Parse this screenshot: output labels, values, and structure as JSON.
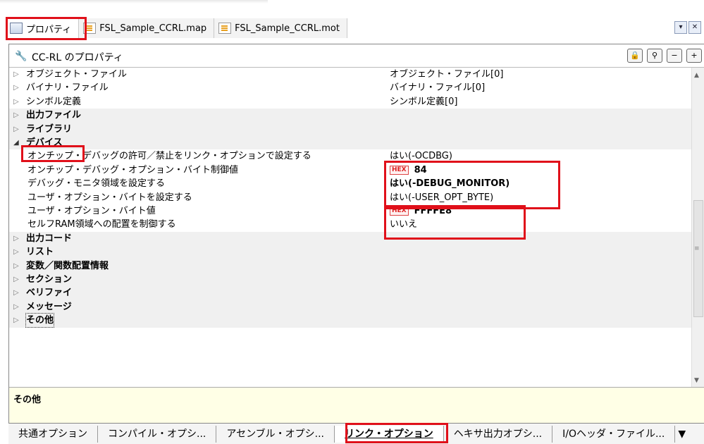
{
  "top_tabs": [
    {
      "label": "プロパティ"
    },
    {
      "label": "FSL_Sample_CCRL.map"
    },
    {
      "label": "FSL_Sample_CCRL.mot"
    }
  ],
  "window_buttons": {
    "dropdown": "▾",
    "close": "✕"
  },
  "panel": {
    "title": "CC-RL のプロパティ",
    "icons": {
      "lock": "🔒",
      "search": "⚲",
      "minus": "−",
      "plus": "+"
    }
  },
  "rows": [
    {
      "name": "オブジェクト・ファイル",
      "value": "オブジェクト・ファイル[0]"
    },
    {
      "name": "バイナリ・ファイル",
      "value": "バイナリ・ファイル[0]"
    },
    {
      "name": "シンボル定義",
      "value": "シンボル定義[0]"
    },
    {
      "name": "出力ファイル"
    },
    {
      "name": "ライブラリ"
    },
    {
      "name": "デバイス"
    },
    {
      "name": "オンチップ・デバッグの許可／禁止をリンク・オプションで設定する",
      "value": "はい(-OCDBG)"
    },
    {
      "name": "オンチップ・デバッグ・オプション・バイト制御値",
      "hex": "HEX",
      "value": "84"
    },
    {
      "name": "デバッグ・モニタ領域を設定する",
      "value": "はい(-DEBUG_MONITOR)"
    },
    {
      "name": "ユーザ・オプション・バイトを設定する",
      "value": "はい(-USER_OPT_BYTE)"
    },
    {
      "name": "ユーザ・オプション・バイト値",
      "hex": "HEX",
      "value": "FFFFE8"
    },
    {
      "name": "セルフRAM領域への配置を制御する",
      "value": "いいえ"
    },
    {
      "name": "出力コード"
    },
    {
      "name": "リスト"
    },
    {
      "name": "変数／関数配置情報"
    },
    {
      "name": "セクション"
    },
    {
      "name": "ベリファイ"
    },
    {
      "name": "メッセージ"
    },
    {
      "name": "その他"
    }
  ],
  "description": {
    "title": "その他"
  },
  "bottom_tabs": [
    {
      "label": "共通オプション"
    },
    {
      "label": "コンパイル・オプシ..."
    },
    {
      "label": "アセンブル・オプシ..."
    },
    {
      "label": "リンク・オプション"
    },
    {
      "label": "ヘキサ出力オプシ..."
    },
    {
      "label": "I/Oヘッダ・ファイル..."
    },
    {
      "label": "▼"
    }
  ]
}
